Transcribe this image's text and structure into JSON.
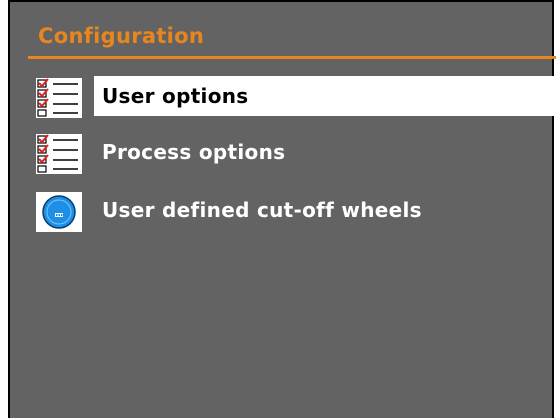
{
  "header": {
    "title": "Configuration"
  },
  "menu": {
    "items": [
      {
        "label": "User options",
        "icon": "checklist-icon",
        "selected": true
      },
      {
        "label": "Process options",
        "icon": "checklist-icon",
        "selected": false
      },
      {
        "label": "User defined cut-off wheels",
        "icon": "cut-off-wheel-icon",
        "selected": false
      }
    ]
  },
  "colors": {
    "panel_background": "#636363",
    "accent": "#E8861E",
    "text": "#FFFFFF",
    "selected_background": "#FFFFFF",
    "selected_text": "#000000",
    "wheel_blue": "#1E8FE6"
  }
}
